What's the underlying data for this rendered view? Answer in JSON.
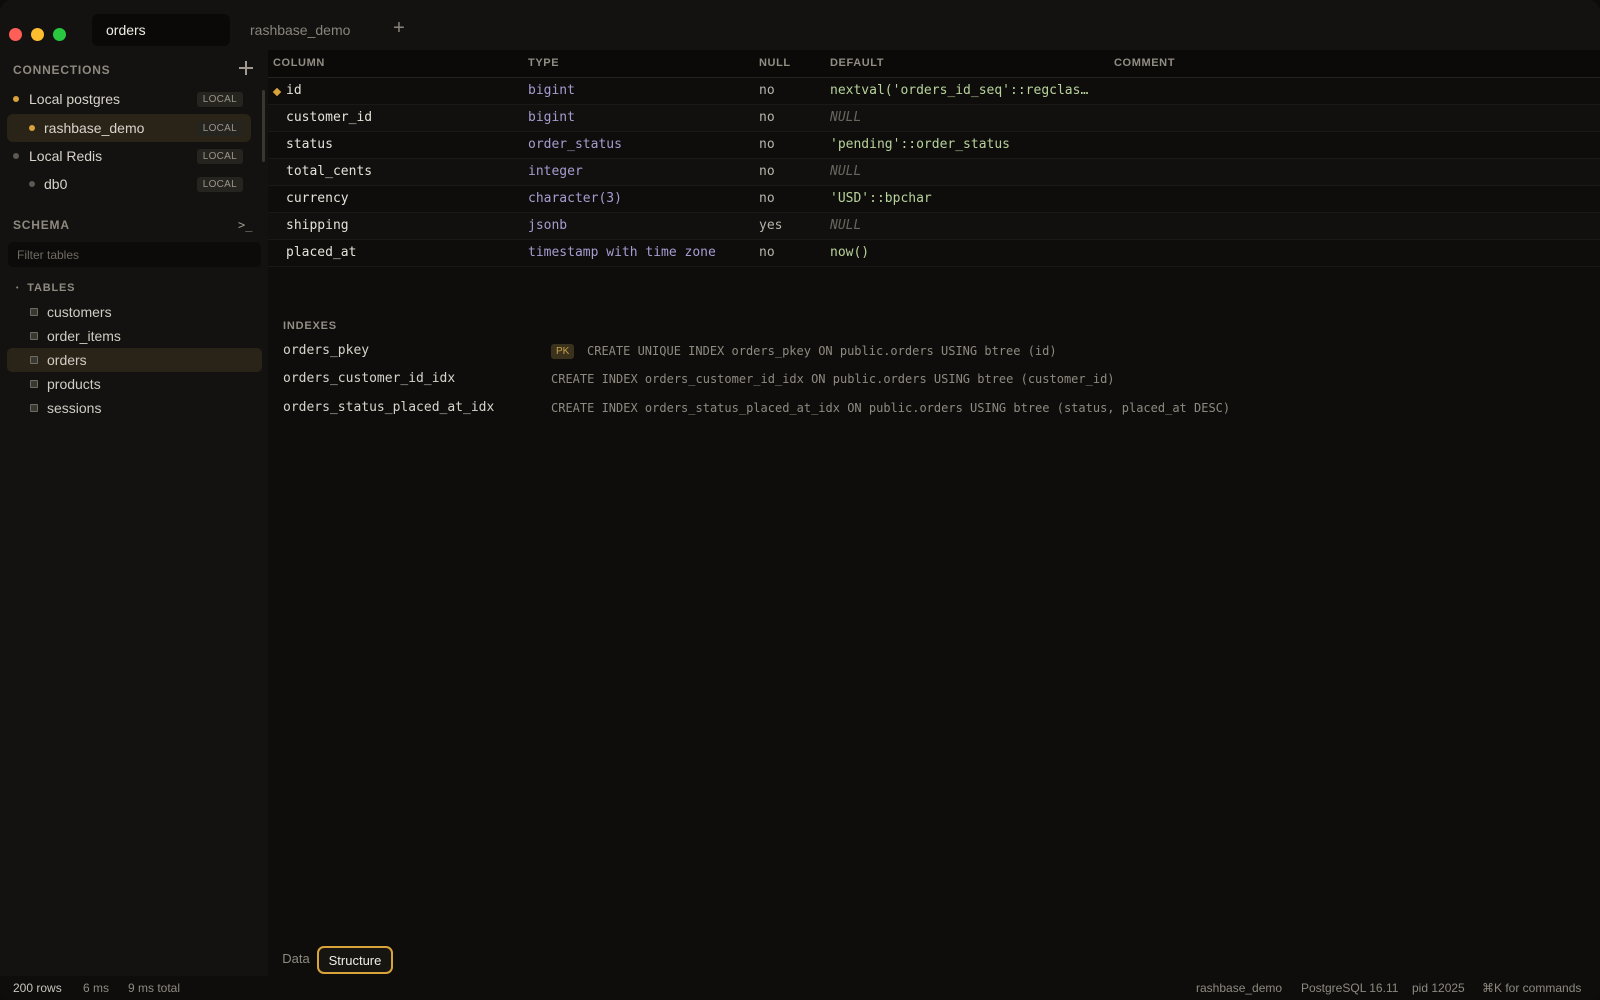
{
  "tabs": [
    {
      "label": "orders",
      "active": true
    },
    {
      "label": "rashbase_demo",
      "active": false
    }
  ],
  "sidebar": {
    "connections_title": "CONNECTIONS",
    "connections": [
      {
        "name": "Local postgres",
        "badge": "LOCAL",
        "dot_color": "#d8a43a",
        "selected": false
      },
      {
        "name": "rashbase_demo",
        "badge": "LOCAL",
        "dot_color": "#d8a43a",
        "selected": true
      },
      {
        "name": "Local Redis",
        "badge": "LOCAL",
        "dot_color": "#5d5952",
        "selected": false
      },
      {
        "name": "db0",
        "badge": "LOCAL",
        "dot_color": "#5d5952",
        "selected": false
      }
    ],
    "schema_title": "SCHEMA",
    "terminal_icon": ">_",
    "filter_placeholder": "Filter tables",
    "tables_title": "TABLES",
    "tables": [
      {
        "name": "customers",
        "selected": false
      },
      {
        "name": "order_items",
        "selected": false
      },
      {
        "name": "orders",
        "selected": true
      },
      {
        "name": "products",
        "selected": false
      },
      {
        "name": "sessions",
        "selected": false
      }
    ]
  },
  "structure": {
    "headers": [
      "COLUMN",
      "TYPE",
      "NULL",
      "DEFAULT",
      "COMMENT"
    ],
    "columns": [
      {
        "name": "id",
        "type": "bigint",
        "null": "no",
        "default": "nextval('orders_id_seq'::regclas…",
        "primary_key": true
      },
      {
        "name": "customer_id",
        "type": "bigint",
        "null": "no",
        "default": "NULL"
      },
      {
        "name": "status",
        "type": "order_status",
        "null": "no",
        "default": "'pending'::order_status"
      },
      {
        "name": "total_cents",
        "type": "integer",
        "null": "no",
        "default": "NULL"
      },
      {
        "name": "currency",
        "type": "character(3)",
        "null": "no",
        "default": "'USD'::bpchar"
      },
      {
        "name": "shipping",
        "type": "jsonb",
        "null": "yes",
        "default": "NULL"
      },
      {
        "name": "placed_at",
        "type": "timestamp with time zone",
        "null": "no",
        "default": "now()"
      }
    ],
    "indexes_title": "INDEXES",
    "indexes": [
      {
        "name": "orders_pkey",
        "badge": "PK",
        "definition": "CREATE UNIQUE INDEX orders_pkey ON public.orders USING btree (id)"
      },
      {
        "name": "orders_customer_id_idx",
        "definition": "CREATE INDEX orders_customer_id_idx ON public.orders USING btree (customer_id)"
      },
      {
        "name": "orders_status_placed_at_idx",
        "definition": "CREATE INDEX orders_status_placed_at_idx ON public.orders USING btree (status, placed_at DESC)"
      }
    ]
  },
  "view_tabs": {
    "data": "Data",
    "structure": "Structure"
  },
  "status": {
    "rows": "200 rows",
    "query_time": "6 ms",
    "total_time": "9 ms total",
    "database": "rashbase_demo",
    "server": "PostgreSQL 16.11",
    "pid": "pid 12025",
    "shortcut": "⌘K for commands"
  },
  "colors": {
    "accent": "#d8a43a",
    "type_text": "#a99bd0",
    "default_text": "#b7d39a"
  }
}
